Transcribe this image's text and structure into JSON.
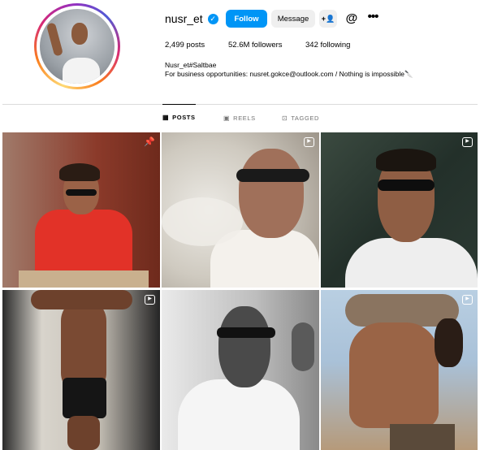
{
  "profile": {
    "username": "nusr_et",
    "verified": true,
    "follow_label": "Follow",
    "message_label": "Message",
    "add_user_icon": "add-user-icon",
    "threads_icon": "threads-icon",
    "more_icon": "more-options-icon"
  },
  "stats": {
    "posts_count": "2,499",
    "posts_label": "posts",
    "followers_count": "52.6M",
    "followers_label": "followers",
    "following_count": "342",
    "following_label": "following"
  },
  "bio": {
    "line1": "Nusr_et#Saltbae",
    "line2": "For business opportunities: nusret.gokce@outlook.com / Nothing is impossible🔪"
  },
  "tabs": [
    {
      "label": "POSTS",
      "icon": "grid-icon",
      "active": true
    },
    {
      "label": "REELS",
      "icon": "reels-icon",
      "active": false
    },
    {
      "label": "TAGGED",
      "icon": "tagged-icon",
      "active": false
    }
  ],
  "grid": [
    {
      "type": "pinned",
      "icon": "pin-icon"
    },
    {
      "type": "reel",
      "icon": "reel-icon"
    },
    {
      "type": "reel",
      "icon": "reel-icon"
    },
    {
      "type": "reel",
      "icon": "reel-icon"
    },
    {
      "type": "post",
      "icon": ""
    },
    {
      "type": "reel",
      "icon": "reel-icon"
    }
  ],
  "colors": {
    "accent": "#0095f6",
    "button_secondary": "#efefef",
    "divider": "#dbdbdb",
    "muted_text": "#737373"
  }
}
